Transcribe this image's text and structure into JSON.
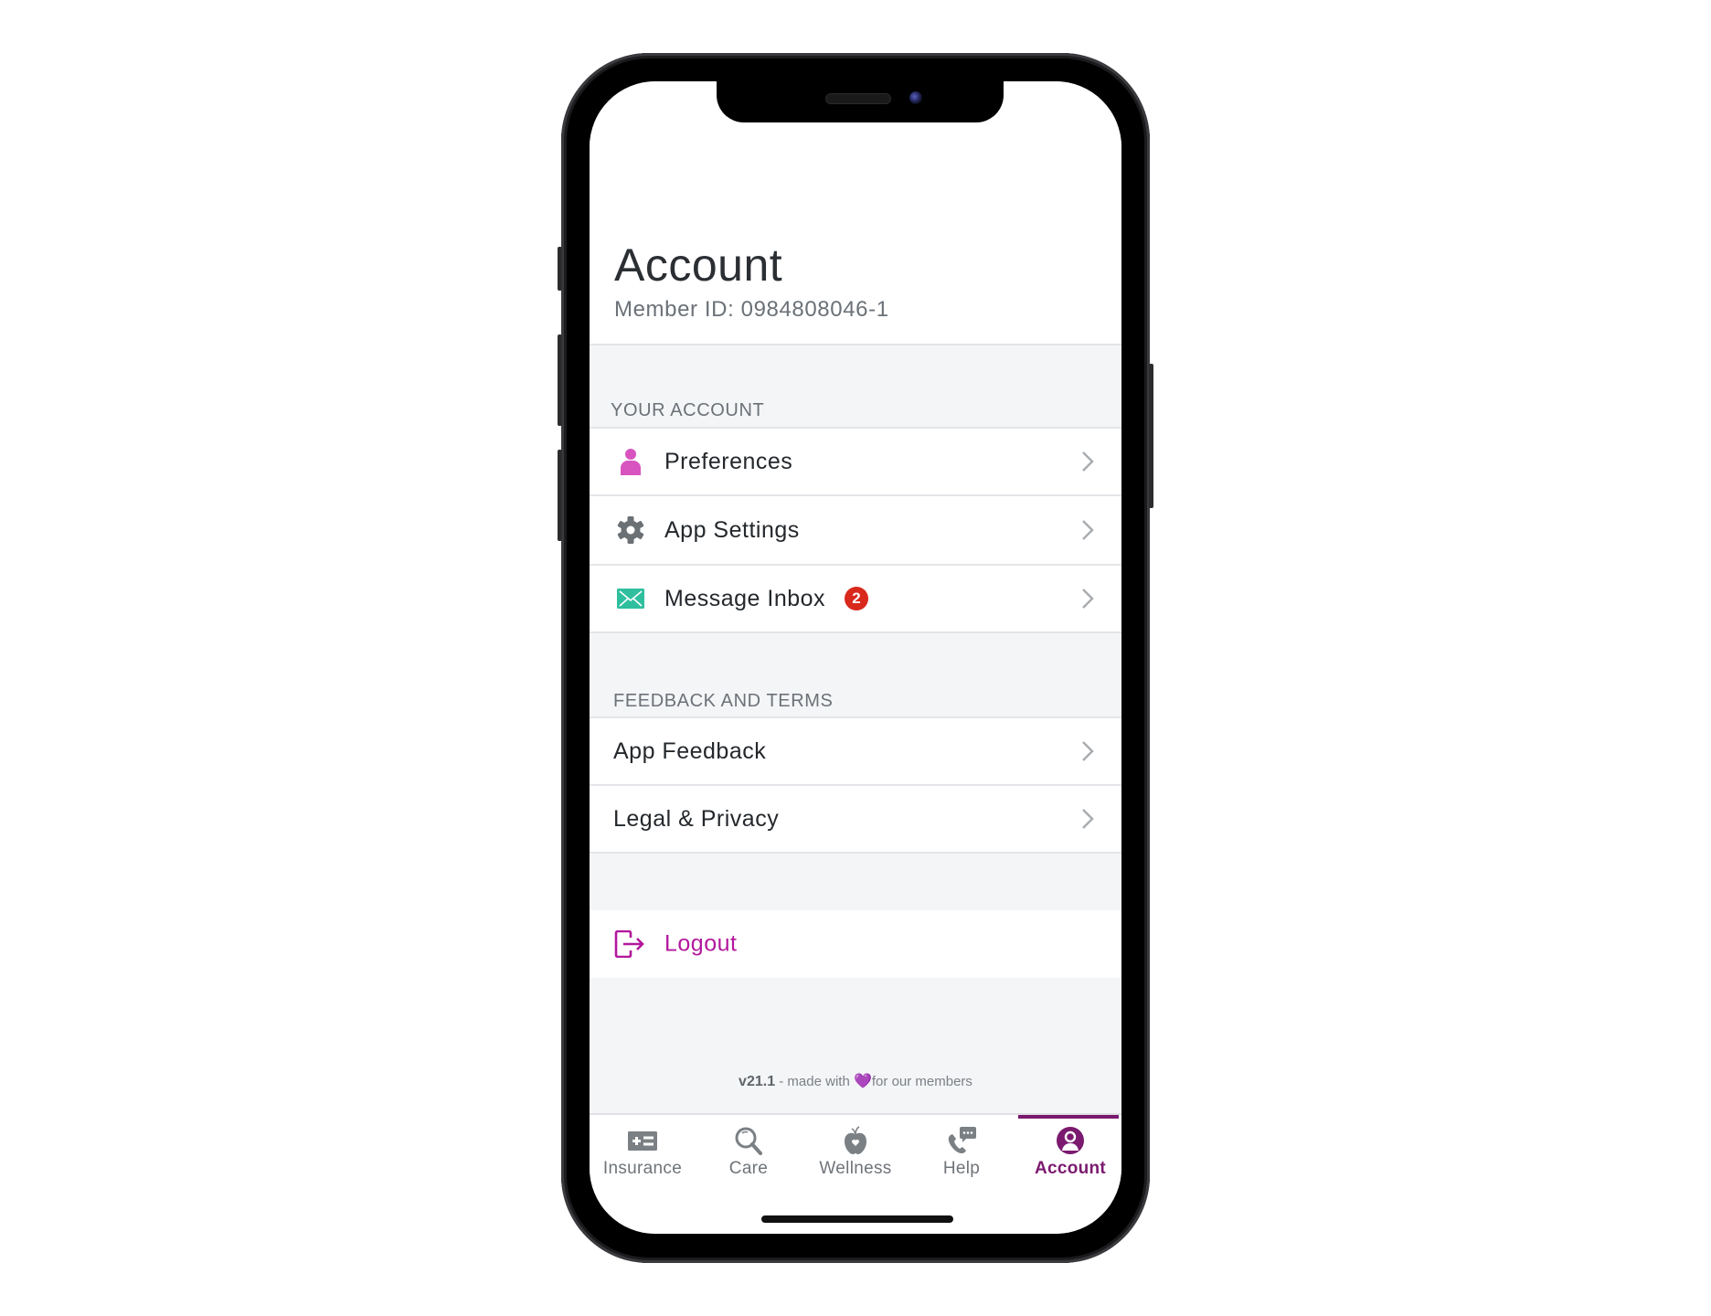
{
  "header": {
    "title": "Account",
    "member_id": "Member ID: 0984808046-1"
  },
  "sections": [
    {
      "label": "YOUR ACCOUNT",
      "items": [
        {
          "label": "Preferences",
          "icon": "person-icon",
          "icon_color": "#d855c0"
        },
        {
          "label": "App Settings",
          "icon": "gear-icon",
          "icon_color": "#6b7075"
        },
        {
          "label": "Message Inbox",
          "icon": "envelope-icon",
          "icon_color": "#2fbf9f",
          "badge": "2"
        }
      ]
    },
    {
      "label": "FEEDBACK AND TERMS",
      "items": [
        {
          "label": "App Feedback"
        },
        {
          "label": "Legal & Privacy"
        }
      ]
    }
  ],
  "logout": {
    "label": "Logout",
    "icon": "logout-icon",
    "color": "#b3179d"
  },
  "footer": {
    "version": "v21.1",
    "text_before_heart": " - made with ",
    "heart": "💜",
    "text_after_heart": "for our members"
  },
  "tabbar": {
    "tabs": [
      {
        "label": "Insurance",
        "icon": "insurance-card-icon",
        "active": false
      },
      {
        "label": "Care",
        "icon": "search-icon",
        "active": false
      },
      {
        "label": "Wellness",
        "icon": "apple-icon",
        "active": false
      },
      {
        "label": "Help",
        "icon": "phone-chat-icon",
        "active": false
      },
      {
        "label": "Account",
        "icon": "account-icon",
        "active": true
      }
    ]
  },
  "colors": {
    "accent": "#7b1a6f",
    "logout": "#b3179d",
    "badge": "#d9281c",
    "background": "#f4f5f7"
  }
}
